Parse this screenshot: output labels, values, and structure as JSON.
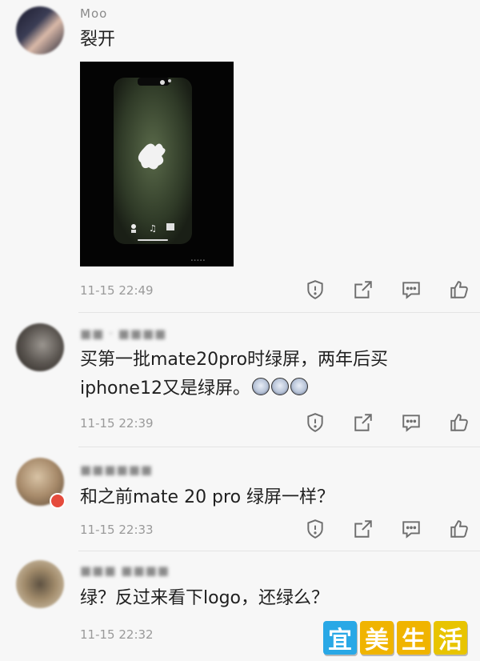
{
  "comments": [
    {
      "username": "Moo",
      "text": "裂开",
      "time": "11-15 22:49"
    },
    {
      "username": "■■ · ■■■■",
      "text_line1": "买第一批mate20pro时绿屏，两年后买",
      "text_line2": "iphone12又是绿屏。",
      "time": "11-15 22:39"
    },
    {
      "username": "■■■■■■",
      "text": "和之前mate 20 pro 绿屏一样？",
      "time": "11-15 22:33"
    },
    {
      "username": "■■■ ■■■■",
      "text": "绿？反过来看下logo，还绿么？",
      "time": "11-15 22:32"
    }
  ],
  "icons": {
    "report": "shield-exclamation-icon",
    "share": "share-arrow-icon",
    "reply": "comment-bubble-icon",
    "like": "thumbs-up-icon"
  },
  "watermark": {
    "chars": [
      "宜",
      "美",
      "生",
      "活"
    ],
    "colors": [
      "#29a8e6",
      "#f0b400",
      "#f0b400",
      "#e8c400"
    ]
  }
}
